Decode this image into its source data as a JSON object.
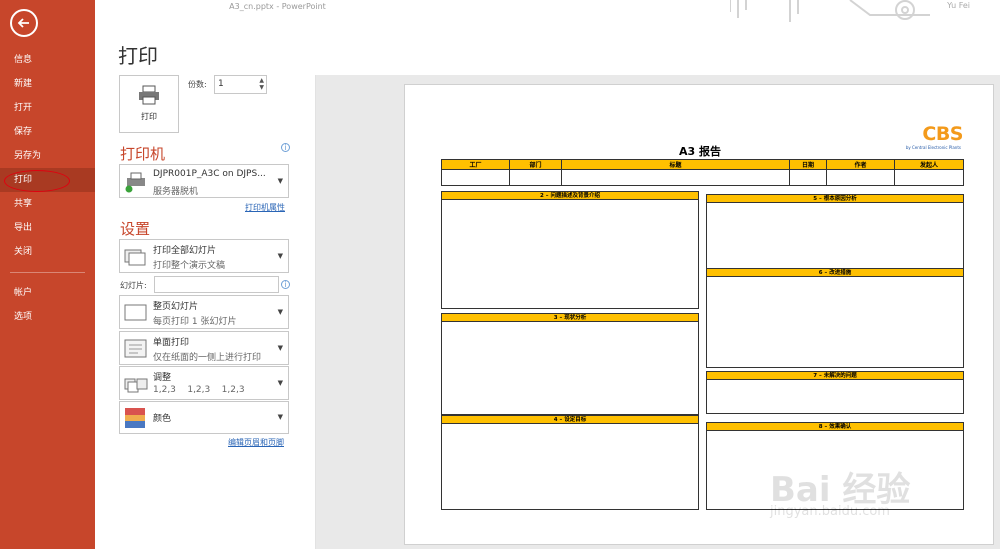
{
  "window": {
    "filename": "A3_cn.pptx",
    "separator": " - ",
    "app": "PowerPoint",
    "user": "Yu Fei"
  },
  "sidebar": {
    "items": [
      {
        "label": "信息"
      },
      {
        "label": "新建"
      },
      {
        "label": "打开"
      },
      {
        "label": "保存"
      },
      {
        "label": "另存为"
      },
      {
        "label": "打印"
      },
      {
        "label": "共享"
      },
      {
        "label": "导出"
      },
      {
        "label": "关闭"
      }
    ],
    "bottom_items": [
      {
        "label": "帐户"
      },
      {
        "label": "选项"
      }
    ]
  },
  "page": {
    "title": "打印"
  },
  "print": {
    "button_label": "打印",
    "copies_label": "份数:",
    "copies_value": "1"
  },
  "printer": {
    "heading": "打印机",
    "name": "DJPR001P_A3C on DJPS...",
    "status": "服务器脱机",
    "properties_link": "打印机属性"
  },
  "settings": {
    "heading": "设置",
    "range_title": "打印全部幻灯片",
    "range_sub": "打印整个演示文稿",
    "slides_label": "幻灯片:",
    "slides_value": "",
    "layout_title": "整页幻灯片",
    "layout_sub": "每页打印 1 张幻灯片",
    "sides_title": "单面打印",
    "sides_sub": "仅在纸面的一侧上进行打印",
    "collate_title": "调整",
    "collate_sub": "1,2,3    1,2,3    1,2,3",
    "color_title": "颜色",
    "header_footer_link": "编辑页眉和页脚"
  },
  "slide": {
    "title": "A3 报告",
    "logo": "CBS",
    "logo_sub": "by Central Electronic Plants",
    "header_columns": [
      "工厂",
      "部门",
      "标题",
      "日期",
      "作者",
      "发起人"
    ],
    "sections": [
      "2 – 问题描述及背景介绍",
      "3 – 现状分析",
      "4 – 设定目标",
      "5 – 根本原因分析",
      "6 – 改进措施",
      "7 – 未解决的问题",
      "8 – 效果确认"
    ]
  },
  "watermark": {
    "main": "Bai 经验",
    "sub": "jingyan.baidu.com"
  },
  "colors": {
    "sidebar": "#c7462b",
    "accent": "#c7462b",
    "slide_header": "#ffc000"
  }
}
